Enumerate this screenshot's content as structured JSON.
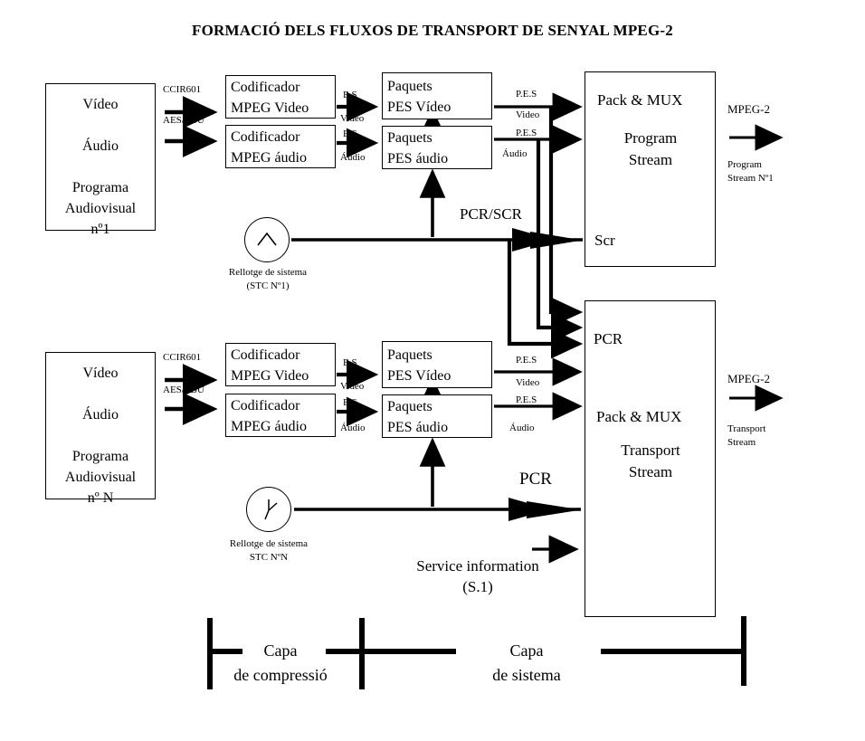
{
  "title": "FORMACIÓ DELS FLUXOS DE TRANSPORT DE SENYAL MPEG-2",
  "program_1": {
    "source_box": "Vídeo\n\nÁudio\n\nPrograma\nAudiovisual\nnº1",
    "source_lines": [
      "Vídeo",
      "Áudio",
      "Programa",
      "Audiovisual",
      "nº1"
    ],
    "interface_video": "CCIR601",
    "interface_audio": "AES/EBU",
    "encoder_video": "Codificador\nMPEG Video",
    "encoder_audio": "Codificador\nMPEG áudio",
    "es_video": "E.S\n\nVideo",
    "es_video_top": "E.S",
    "es_video_bottom": "Video",
    "es_audio_top": "E.S",
    "es_audio_bottom": "Áudio",
    "pes_video": "Paquets\nPES Vídeo",
    "pes_audio": "Paquets\nPES áudio",
    "pes_out_video_top": "P.E.S",
    "pes_out_video_bottom": "Video",
    "pes_out_audio_top": "P.E.S",
    "pes_out_audio_bottom": "Áudio",
    "clock_caption": "Rellotge de sistema\n(STC Nº1)",
    "clock_icon": "peak-waveform-icon",
    "pcr_scr_label": "PCR/SCR",
    "mux_title": "Pack & MUX",
    "mux_subtitle": "Program\nStream",
    "mux_scr_label": "Scr",
    "output_standard": "MPEG-2",
    "output_caption": "Program\nStream Nº1"
  },
  "program_n": {
    "source_box": "Vídeo\n\nÁudio\n\nPrograma\nAudiovisual\nnº N",
    "source_lines": [
      "Vídeo",
      "Áudio",
      "Programa",
      "Audiovisual",
      "nº N"
    ],
    "interface_video": "CCIR601",
    "interface_audio": "AES/EBU",
    "encoder_video": "Codificador\nMPEG Video",
    "encoder_audio": "Codificador\nMPEG áudio",
    "es_video_top": "E.S",
    "es_video_bottom": "Video",
    "es_audio_top": "E.S",
    "es_audio_bottom": "Áudio",
    "pes_video": "Paquets\nPES Vídeo",
    "pes_audio": "Paquets\nPES áudio",
    "pes_out_video_top": "P.E.S",
    "pes_out_video_bottom": "Video",
    "pes_out_audio_top": "P.E.S",
    "pes_out_audio_bottom": "Áudio",
    "clock_caption": "Rellotge de sistema\nSTC NºN",
    "clock_icon": "clock-hands-icon",
    "pcr_label": "PCR",
    "mux_pcr_label": "PCR",
    "mux_title": "Pack & MUX",
    "mux_subtitle": "Transport\nStream",
    "service_info": "Service information\n(S.1)",
    "output_standard": "MPEG-2",
    "output_caption": "Transport\nStream"
  },
  "layers": {
    "compression": "Capa\nde compressió",
    "system": "Capa\nde sistema"
  },
  "colors": {
    "stroke": "#000000",
    "background": "#ffffff"
  }
}
